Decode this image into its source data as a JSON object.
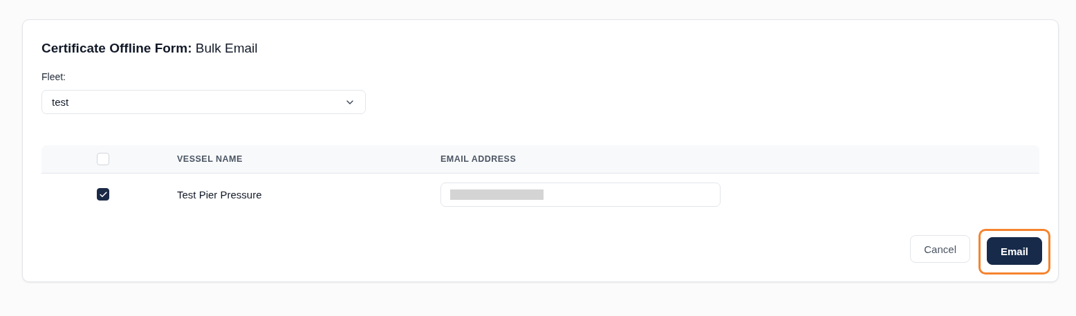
{
  "form": {
    "title_bold": "Certificate Offline Form:",
    "title_rest": "Bulk Email"
  },
  "fleet": {
    "label": "Fleet:",
    "value": "test"
  },
  "table": {
    "select_all": {
      "checked": false
    },
    "columns": [
      "VESSEL NAME",
      "EMAIL ADDRESS"
    ],
    "rows": [
      {
        "checked": true,
        "vessel": "Test Pier Pressure",
        "email_redacted": true
      }
    ]
  },
  "buttons": [
    {
      "kind": "secondary",
      "label": "Cancel",
      "highlighted": false
    },
    {
      "kind": "primary",
      "label": "Email",
      "highlighted": true
    }
  ]
}
